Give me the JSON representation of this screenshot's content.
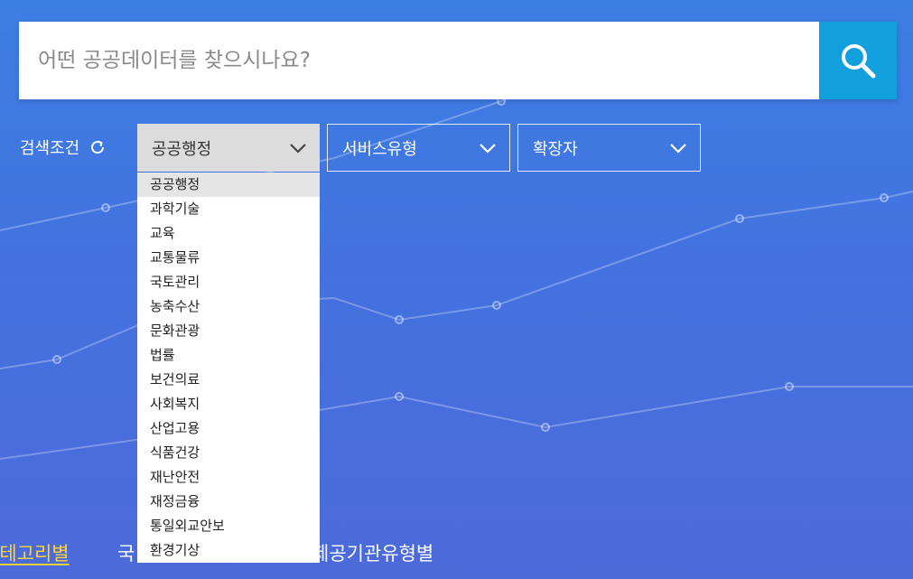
{
  "search": {
    "placeholder": "어떤 공공데이터를 찾으시나요?"
  },
  "filter": {
    "label": "검색조건",
    "category_select": {
      "selected": "공공행정",
      "options": [
        "공공행정",
        "과학기술",
        "교육",
        "교통물류",
        "국토관리",
        "농축수산",
        "문화관광",
        "법률",
        "보건의료",
        "사회복지",
        "산업고용",
        "식품건강",
        "재난안전",
        "재정금융",
        "통일외교안보",
        "환경기상"
      ]
    },
    "service_type_select": {
      "selected": "서비스유형"
    },
    "extension_select": {
      "selected": "확장자"
    }
  },
  "category_tabs": {
    "tab1": "카테고리별",
    "tab2": "국",
    "tab3": "제공기관유형별"
  },
  "colors": {
    "background_top": "#3c7fe3",
    "background_bottom": "#4d6ad9",
    "search_button": "#129fdd",
    "selected_tab": "#ffd233"
  }
}
